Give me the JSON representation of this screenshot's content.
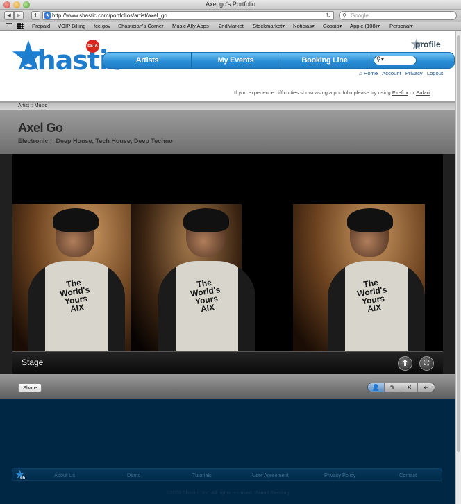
{
  "window": {
    "title": "Axel go's Portfolio"
  },
  "toolbar": {
    "back": "◀",
    "forward": "▶",
    "add": "+",
    "url": "http://www.shastic.com/portfolios/artist/axel_go",
    "search_placeholder": "Google"
  },
  "bookmarks": [
    "Prepaid",
    "VOIP Billing",
    "fcc.gov",
    "Shastician's Corner",
    "Music Ally Apps",
    "2ndMarket",
    "Stockmarket▾",
    "Noticias▾",
    "Gossip▾",
    "Apple (108)▾",
    "Personal▾"
  ],
  "site": {
    "logo": "shastic",
    "beta": "BETA",
    "profile": "profile",
    "nav": [
      "Artists",
      "My Events",
      "Booking Line"
    ],
    "user_links": [
      "Home",
      "Account",
      "Privacy",
      "Logout"
    ],
    "notice_prefix": "If you experience difficulties showcasing a portfolio please try using",
    "notice_firefox": "Firefox",
    "notice_or": "or",
    "notice_safari": "Safari",
    "notice_end": "."
  },
  "breadcrumb": "Artist :: Music",
  "artist": {
    "name": "Axel Go",
    "genres": "Electronic :: Deep House, Tech House, Deep Techno"
  },
  "stage": {
    "title": "Stage",
    "shirt_text": [
      "The",
      "World's",
      "Yours",
      "AIX"
    ]
  },
  "share": {
    "label": "Share"
  },
  "footer": {
    "logo": "sh",
    "links": [
      "About Us",
      "Demo",
      "Tutorials",
      "User Agreement",
      "Privacy Policy",
      "Contact"
    ],
    "copyright": "©2009 Shastic, Inc. All rights reserved. Patent Pending"
  },
  "colors": {
    "brand_blue": "#1d7ccc",
    "bottom_navy": "#002744"
  }
}
